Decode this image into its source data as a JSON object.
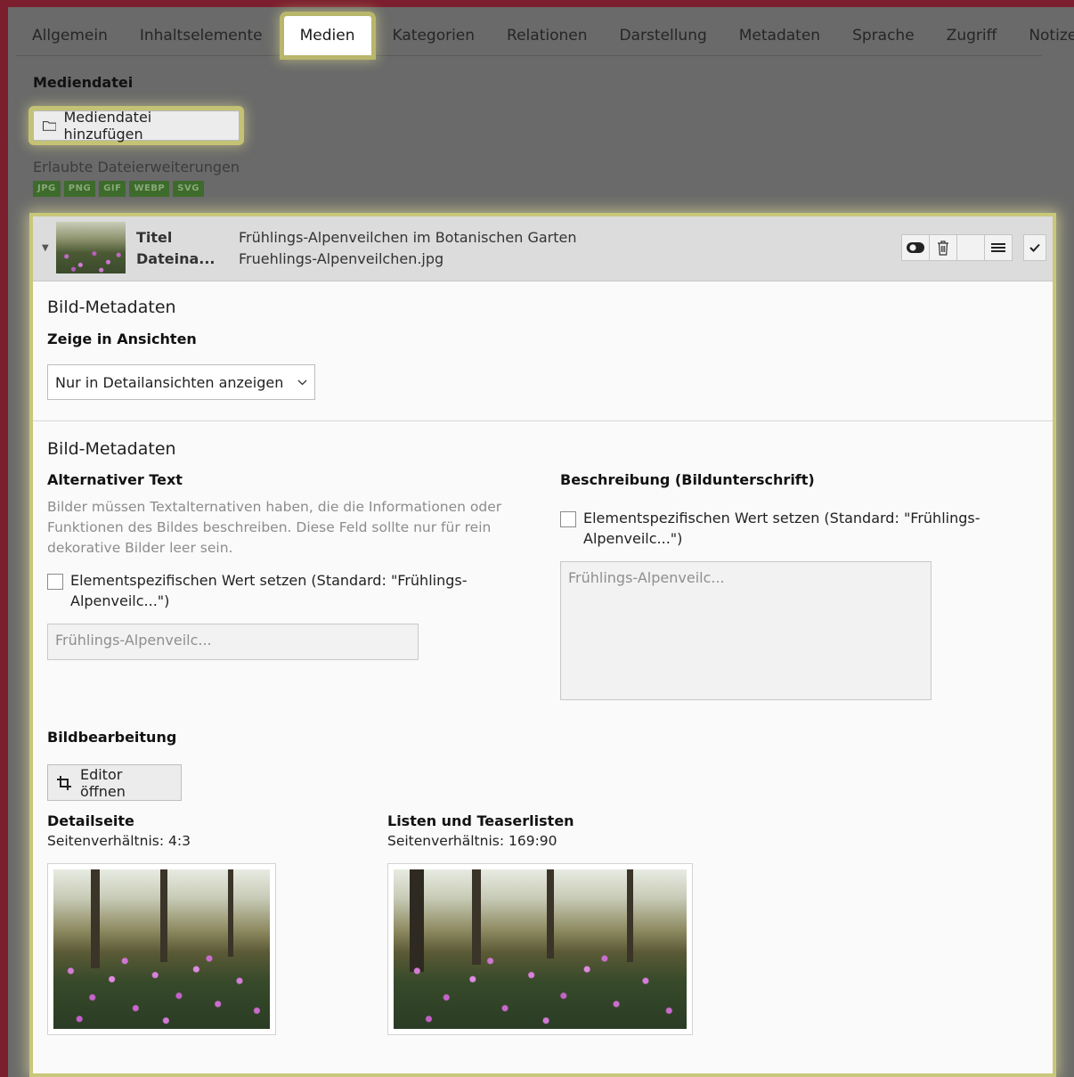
{
  "tabs": [
    {
      "label": "Allgemein"
    },
    {
      "label": "Inhaltselemente"
    },
    {
      "label": "Medien",
      "active": true
    },
    {
      "label": "Kategorien"
    },
    {
      "label": "Relationen"
    },
    {
      "label": "Darstellung"
    },
    {
      "label": "Metadaten"
    },
    {
      "label": "Sprache"
    },
    {
      "label": "Zugriff"
    },
    {
      "label": "Notizen"
    }
  ],
  "media": {
    "section_title": "Mediendatei",
    "add_button": "Mediendatei hinzufügen",
    "allowed_label": "Erlaubte Dateierweiterungen",
    "extensions": [
      "JPG",
      "PNG",
      "GIF",
      "WEBP",
      "SVG"
    ]
  },
  "file": {
    "title_key": "Titel",
    "title_value": "Frühlings-Alpenveilchen im Botanischen Garten",
    "filename_key": "Dateina...",
    "filename_value": "Fruehlings-Alpenveilchen.jpg"
  },
  "meta1": {
    "heading": "Bild-Metadaten",
    "show_label": "Zeige in Ansichten",
    "show_value": "Nur in Detailansichten anzeigen"
  },
  "meta2": {
    "heading": "Bild-Metadaten",
    "alt_label": "Alternativer Text",
    "alt_help": "Bilder müssen Textalternativen haben, die die Informationen oder Funktionen des Bildes beschreiben. Diese Feld sollte nur für rein dekorative Bilder leer sein.",
    "alt_check_line1": "Elementspezifischen Wert setzen (Standard: \"Frühlings-",
    "alt_check_line2": "Alpenveilc...\")",
    "alt_placeholder": "Frühlings-Alpenveilc...",
    "desc_label": "Beschreibung (Bildunterschrift)",
    "desc_check_line1": "Elementspezifischen Wert setzen (Standard: \"Frühlings-",
    "desc_check_line2": "Alpenveilc...\")",
    "desc_placeholder": "Frühlings-Alpenveilc..."
  },
  "editing": {
    "label": "Bildbearbeitung",
    "editor_button": "Editor öffnen",
    "crops": [
      {
        "name": "Detailseite",
        "ratio": "Seitenverhältnis: 4:3"
      },
      {
        "name": "Listen und Teaserlisten",
        "ratio": "Seitenverhältnis: 169:90"
      }
    ]
  }
}
